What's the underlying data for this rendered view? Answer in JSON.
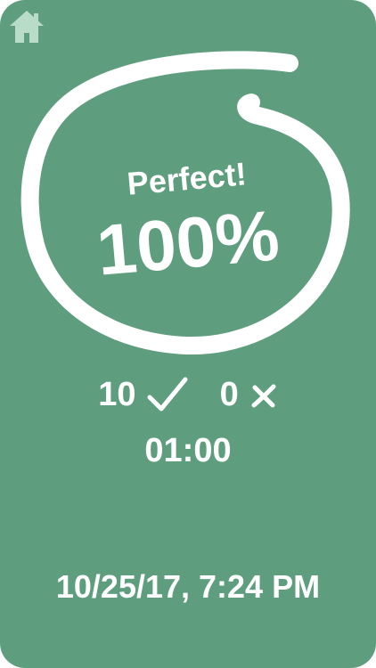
{
  "result": {
    "message": "Perfect!",
    "score": "100%"
  },
  "stats": {
    "correct_count": "10",
    "correct_icon": "checkmark-icon",
    "incorrect_count": "0",
    "incorrect_icon": "cross-icon"
  },
  "elapsed_time": "01:00",
  "timestamp": "10/25/17, 7:24 PM",
  "icons": {
    "home": "home-icon"
  },
  "colors": {
    "background": "#5e9e7e",
    "foreground": "#ffffff",
    "home_icon": "#b9dcc9"
  }
}
